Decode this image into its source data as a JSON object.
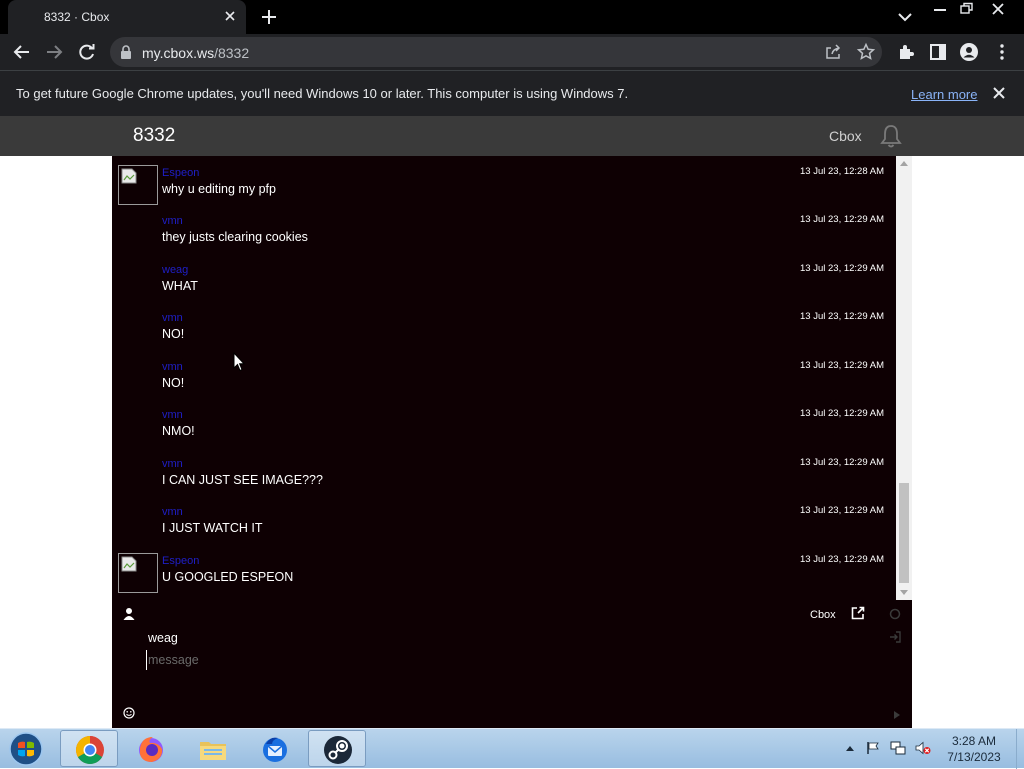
{
  "browser": {
    "tab_title": "8332 · Cbox",
    "url_host": "my.cbox.ws",
    "url_path": "/8332"
  },
  "infobar": {
    "message": "To get future Google Chrome updates, you'll need Windows 10 or later. This computer is using Windows 7.",
    "link_label": "Learn more"
  },
  "site": {
    "title": "8332",
    "brand": "Cbox"
  },
  "messages": [
    {
      "name": "Espeon",
      "text": "why u editing my pfp",
      "time": "13 Jul 23, 12:28 AM",
      "avatar": true
    },
    {
      "name": "vmn",
      "text": "they justs clearing cookies",
      "time": "13 Jul 23, 12:29 AM",
      "avatar": false
    },
    {
      "name": "weag",
      "text": "WHAT",
      "time": "13 Jul 23, 12:29 AM",
      "avatar": false
    },
    {
      "name": "vmn",
      "text": "NO!",
      "time": "13 Jul 23, 12:29 AM",
      "avatar": false
    },
    {
      "name": "vmn",
      "text": "NO!",
      "time": "13 Jul 23, 12:29 AM",
      "avatar": false
    },
    {
      "name": "vmn",
      "text": "NMO!",
      "time": "13 Jul 23, 12:29 AM",
      "avatar": false
    },
    {
      "name": "vmn",
      "text": "I CAN JUST SEE IMAGE???",
      "time": "13 Jul 23, 12:29 AM",
      "avatar": false
    },
    {
      "name": "vmn",
      "text": "I JUST WATCH IT",
      "time": "13 Jul 23, 12:29 AM",
      "avatar": false
    },
    {
      "name": "Espeon",
      "text": "U GOOGLED ESPEON",
      "time": "13 Jul 23, 12:29 AM",
      "avatar": true
    }
  ],
  "composer": {
    "cbox_link": "Cbox",
    "username": "weag",
    "message_placeholder": "message",
    "message_value": ""
  },
  "taskbar": {
    "apps": [
      "chrome",
      "firefox",
      "windows-explorer",
      "thunderbird",
      "steam"
    ],
    "time": "3:28 AM",
    "date": "7/13/2023"
  }
}
